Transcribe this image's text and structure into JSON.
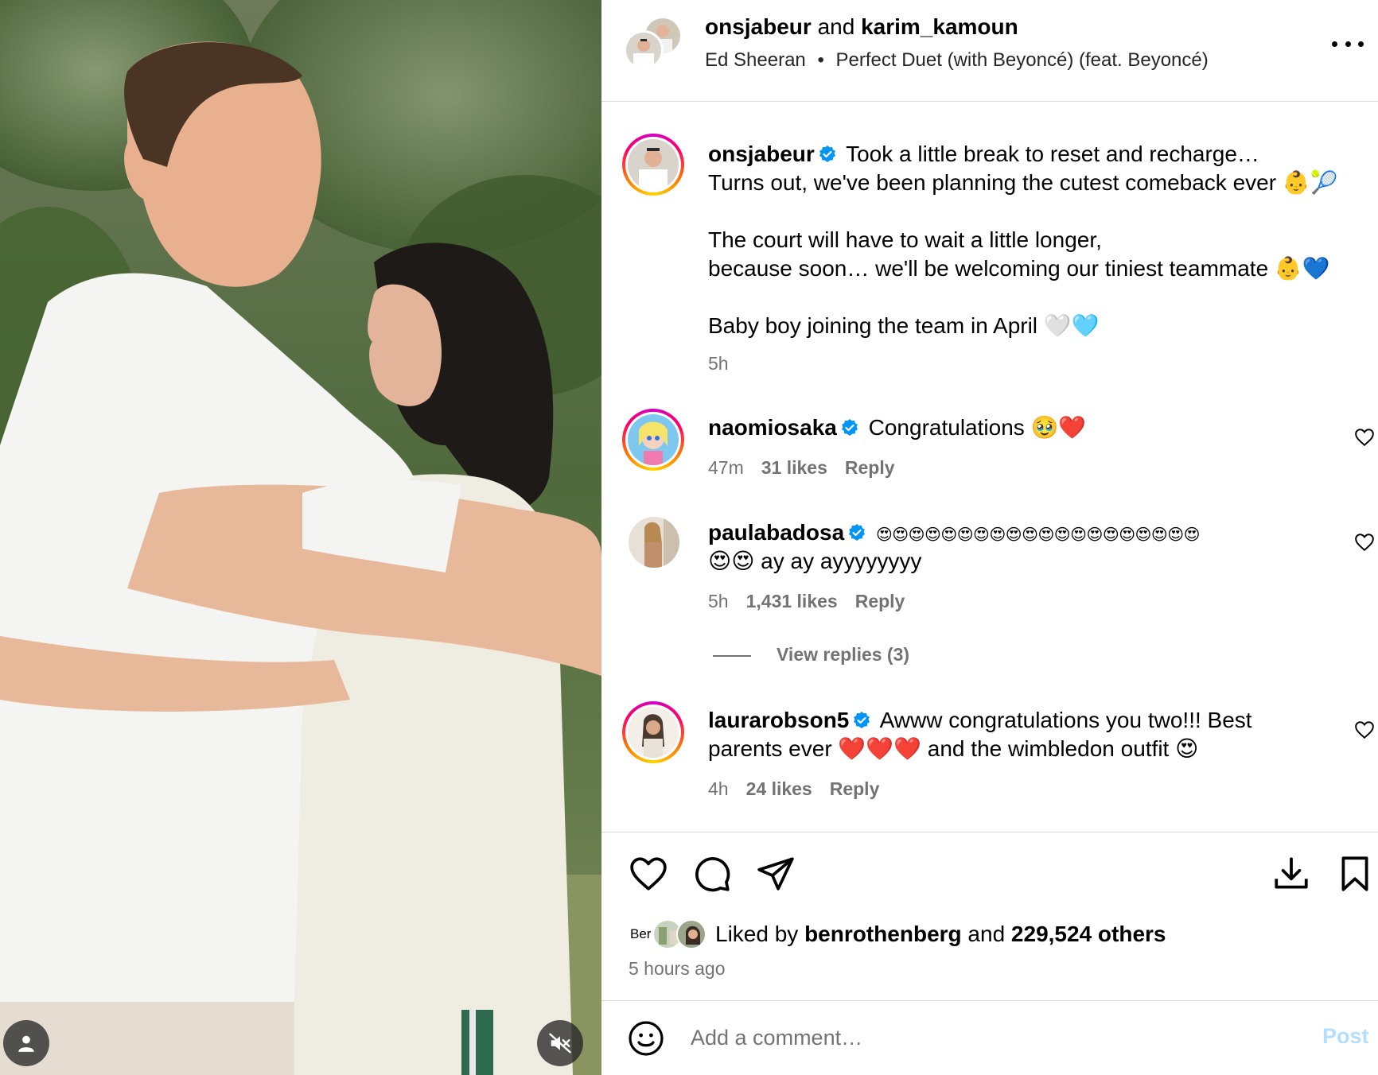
{
  "post": {
    "author": "onsjabeur",
    "and_word": "and",
    "collaborator": "karim_kamoun",
    "audio_artist": "Ed Sheeran",
    "audio_sep": "•",
    "audio_track": "Perfect Duet (with Beyoncé) (feat. Beyoncé)",
    "more_icon": "more-horizontal-icon"
  },
  "caption": {
    "username": "onsjabeur",
    "verified": true,
    "line1": "Took a little break to reset and recharge…",
    "line2": "Turns out, we've been planning the cutest comeback ever 👶🎾",
    "line3": "The court will have to wait a little longer,",
    "line4": "because soon… we'll be welcoming our tiniest teammate 👶💙",
    "line5": "Baby boy joining the team in April 🤍🩵",
    "time": "5h"
  },
  "comments": [
    {
      "username": "naomiosaka",
      "verified": true,
      "text_line1": "Congratulations 🥹❤️",
      "text_line2": "",
      "time": "47m",
      "likes": "31 likes",
      "reply": "Reply"
    },
    {
      "username": "paulabadosa",
      "verified": true,
      "text_line1": "😍😍😍😍😍😍😍😍😍😍😍😍😍😍😍😍😍😍😍😍",
      "text_line2": "😍😍 ay ay ayyyyyyyy",
      "time": "5h",
      "likes": "1,431 likes",
      "reply": "Reply",
      "view_replies": "View replies (3)"
    },
    {
      "username": "laurarobson5",
      "verified": true,
      "text_line1": "Awww congratulations you two!!! Best",
      "text_line2": "parents ever ❤️❤️❤️ and the wimbledon outfit 😍",
      "time": "4h",
      "likes": "24 likes",
      "reply": "Reply"
    }
  ],
  "actions": {
    "like_icon": "heart-icon",
    "comment_icon": "comment-icon",
    "share_icon": "send-icon",
    "download_icon": "download-icon",
    "save_icon": "bookmark-icon"
  },
  "likes": {
    "prefix": "Liked by",
    "liker": "benrothenberg",
    "and_word": "and",
    "others": "229,524 others",
    "avatar_text": "Ber"
  },
  "posted": "5 hours ago",
  "comment_box": {
    "emoji_icon": "smiley-icon",
    "placeholder": "Add a comment…",
    "post_label": "Post"
  },
  "media": {
    "tags_icon": "user-tag-icon",
    "mute_icon": "speaker-muted-icon"
  },
  "colors": {
    "verified_blue": "#0095f6",
    "muted_text": "#737373",
    "post_button_disabled": "#b2dffc",
    "divider": "#dbdbdb"
  }
}
